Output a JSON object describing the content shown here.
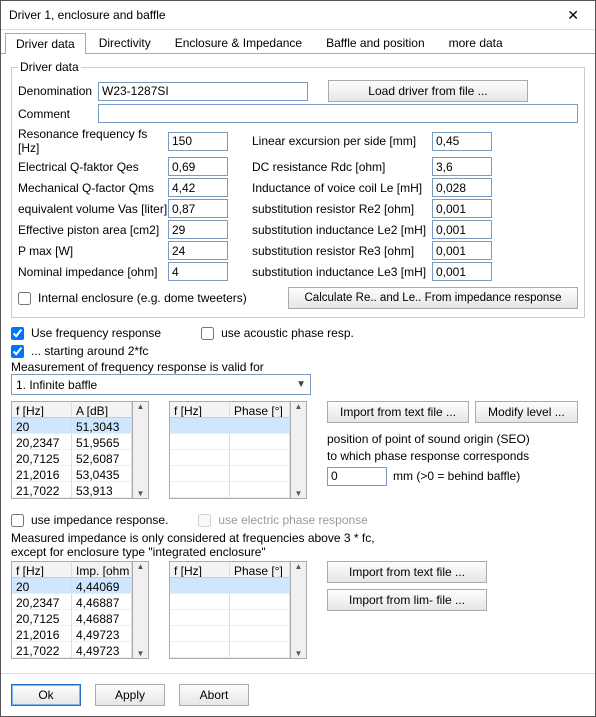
{
  "window": {
    "title": "Driver 1, enclosure and baffle"
  },
  "tabs": {
    "t0": "Driver data",
    "t1": "Directivity",
    "t2": "Enclosure & Impedance",
    "t3": "Baffle and position",
    "t4": "more data"
  },
  "group_title": "Driver data",
  "denom_label": "Denomination",
  "denom_value": "W23-1287SI",
  "load_button": "Load driver from file ...",
  "comment_label": "Comment",
  "comment_value": "",
  "params": {
    "left": {
      "l0": "Resonance frequency fs [Hz]",
      "v0": "150",
      "l1": "Electrical Q-faktor Qes",
      "v1": "0,69",
      "l2": "Mechanical Q-factor Qms",
      "v2": "4,42",
      "l3": "equivalent volume Vas [liter]",
      "v3": "0,87",
      "l4": "Effective piston area [cm2]",
      "v4": "29",
      "l5": "P max [W]",
      "v5": "24",
      "l6": "Nominal impedance [ohm]",
      "v6": "4"
    },
    "right": {
      "l0": "Linear excursion per side [mm]",
      "v0": "0,45",
      "l1": "DC resistance Rdc [ohm]",
      "v1": "3,6",
      "l2": "Inductance of voice coil Le [mH]",
      "v2": "0,028",
      "l3": "substitution resistor Re2 [ohm]",
      "v3": "0,001",
      "l4": "substitution inductance Le2 [mH]",
      "v4": "0,001",
      "l5": "substitution resistor Re3 [ohm]",
      "v5": "0,001",
      "l6": "substitution inductance Le3 [mH]",
      "v6": "0,001"
    }
  },
  "cb_internal": "Internal enclosure (e.g. dome tweeters)",
  "calc_button": "Calculate Re.. and Le.. From impedance response",
  "cb_use_freq": "Use frequency response",
  "cb_use_ac_phase": "use acoustic phase resp.",
  "cb_start_2fc": "... starting around 2*fc",
  "meas_valid_label": "Measurement of frequency response is valid for",
  "combo_value": "1. Infinite baffle",
  "table_freq": {
    "h0": "f [Hz]",
    "h1": "A [dB]",
    "rows": [
      {
        "f": "20",
        "a": "51,3043"
      },
      {
        "f": "20,2347",
        "a": "51,9565"
      },
      {
        "f": "20,7125",
        "a": "52,6087"
      },
      {
        "f": "21,2016",
        "a": "53,0435"
      },
      {
        "f": "21,7022",
        "a": "53,913"
      }
    ]
  },
  "table_phase": {
    "h0": "f [Hz]",
    "h1": "Phase [°]"
  },
  "import_txt": "Import from text file ...",
  "modify_level": "Modify level ...",
  "seo": {
    "line0": "position of point of sound origin (SEO)",
    "line1": "to which phase response corresponds",
    "value": "0",
    "unit": "mm (>0 = behind baffle)"
  },
  "cb_use_imp": "use impedance response.",
  "cb_use_el_phase": "use electric phase response",
  "imp_note0": "Measured impedance is only considered at frequencies above 3 * fc,",
  "imp_note1": "except for enclosure type \"integrated enclosure\"",
  "table_imp": {
    "h0": "f [Hz]",
    "h1": "Imp. [ohm",
    "rows": [
      {
        "f": "20",
        "a": "4,44069"
      },
      {
        "f": "20,2347",
        "a": "4,46887"
      },
      {
        "f": "20,7125",
        "a": "4,46887"
      },
      {
        "f": "21,2016",
        "a": "4,49723"
      },
      {
        "f": "21,7022",
        "a": "4,49723"
      }
    ]
  },
  "import_lim": "Import from lim- file ...",
  "footer": {
    "ok": "Ok",
    "apply": "Apply",
    "abort": "Abort"
  }
}
